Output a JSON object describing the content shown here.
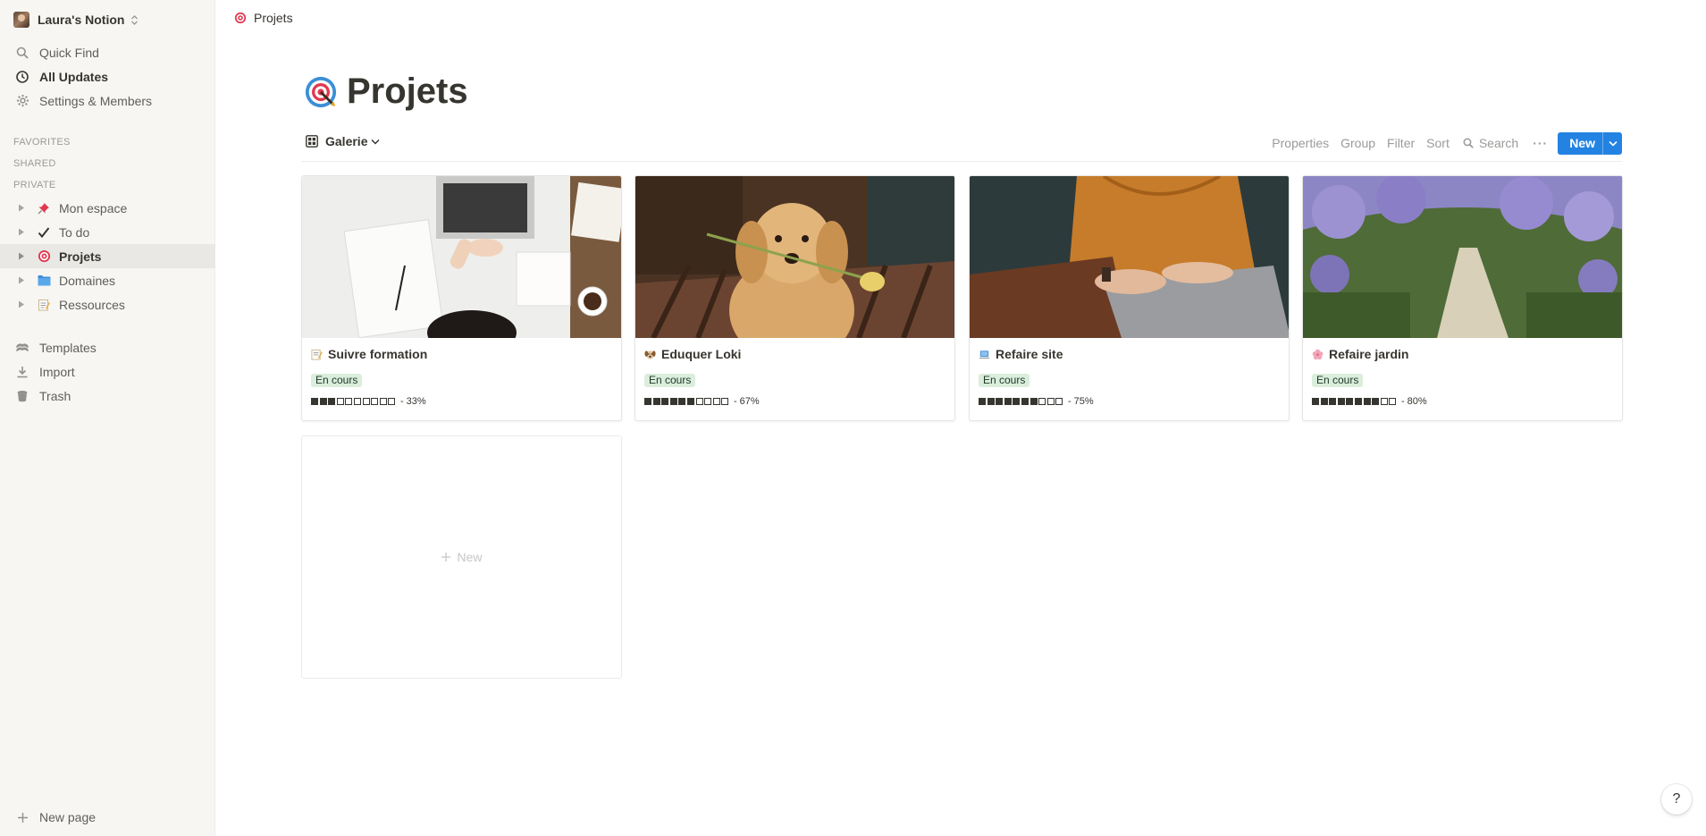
{
  "workspace": {
    "name": "Laura's Notion"
  },
  "sidebar": {
    "quick_find": "Quick Find",
    "all_updates": "All Updates",
    "settings": "Settings & Members",
    "favorites_label": "FAVORITES",
    "shared_label": "SHARED",
    "private_label": "PRIVATE",
    "pages": [
      {
        "label": "Mon espace",
        "icon": "pushpin-icon"
      },
      {
        "label": "To do",
        "icon": "checkmark-icon"
      },
      {
        "label": "Projets",
        "icon": "target-icon",
        "active": true
      },
      {
        "label": "Domaines",
        "icon": "folder-icon"
      },
      {
        "label": "Ressources",
        "icon": "notepad-icon"
      }
    ],
    "templates": "Templates",
    "import": "Import",
    "trash": "Trash",
    "new_page": "New page"
  },
  "breadcrumb": {
    "label": "Projets"
  },
  "page": {
    "title": "Projets"
  },
  "view": {
    "name": "Galerie",
    "properties": "Properties",
    "group": "Group",
    "filter": "Filter",
    "sort": "Sort",
    "search": "Search",
    "more": "···",
    "new": "New"
  },
  "cards": [
    {
      "title": "Suivre formation",
      "icon": "memo-icon",
      "status": "En cours",
      "filled": 3,
      "total": 10,
      "pct": "- 33%"
    },
    {
      "title": "Eduquer Loki",
      "icon": "dog-face-icon",
      "status": "En cours",
      "filled": 6,
      "total": 10,
      "pct": "- 67%"
    },
    {
      "title": "Refaire site",
      "icon": "laptop-icon",
      "status": "En cours",
      "filled": 7,
      "total": 10,
      "pct": "- 75%"
    },
    {
      "title": "Refaire jardin",
      "icon": "blossom-icon",
      "status": "En cours",
      "filled": 8,
      "total": 10,
      "pct": "- 80%"
    }
  ],
  "new_card": {
    "label": "New"
  },
  "help": {
    "label": "?"
  },
  "colors": {
    "accent": "#2383e2",
    "tag_bg": "#dbeddb",
    "sidebar_bg": "#f7f6f3"
  }
}
